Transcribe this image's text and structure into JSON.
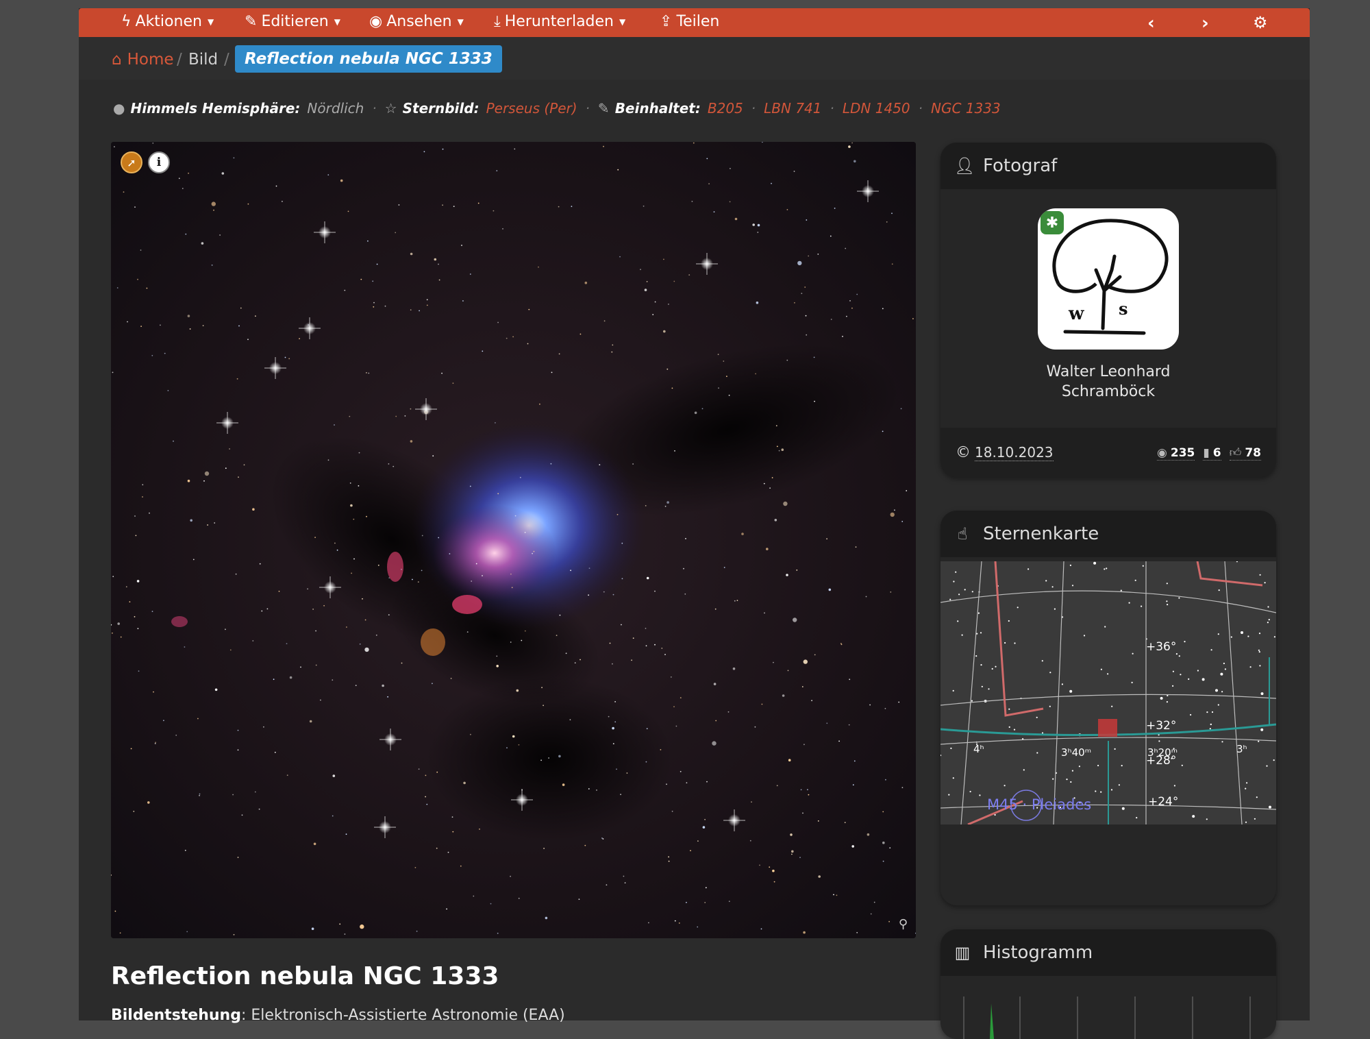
{
  "nav": {
    "actions": "Aktionen",
    "edit": "Editieren",
    "view": "Ansehen",
    "download": "Herunterladen",
    "share": "Teilen"
  },
  "breadcrumb": {
    "home": "Home",
    "sep": "/",
    "section": "Bild",
    "current": "Reflection nebula NGC 1333"
  },
  "meta": {
    "hemisphere_label": "Himmels Hemisphäre:",
    "hemisphere_value": "Nördlich",
    "constellation_label": "Sternbild:",
    "constellation_value": "Perseus (Per)",
    "contains_label": "Beinhaltet:",
    "contains": [
      "B205",
      "LBN 741",
      "LDN 1450",
      "NGC 1333"
    ],
    "sep": "·"
  },
  "image": {
    "title": "Reflection nebula NGC 1333",
    "info_badge": "i",
    "acquisition_label": "Bildentstehung",
    "acquisition_value": "Elektronisch-Assistierte Astronomie (EAA)"
  },
  "photographer_card": {
    "heading": "Fotograf",
    "name_line1": "Walter Leonhard",
    "name_line2": "Schramböck",
    "avatar_initials_w": "w",
    "avatar_initials_s": "s",
    "date": "18.10.2023",
    "views": "235",
    "bookmarks": "6",
    "likes": "78"
  },
  "skymap_card": {
    "heading": "Sternenkarte",
    "labels": {
      "dec36": "+36°",
      "dec32": "+32°",
      "dec28": "+28°",
      "dec24": "+24°",
      "ra4h": "4ʰ",
      "ra340": "3ʰ40ᵐ",
      "ra320": "3ʰ20ᵐ",
      "ra3h": "3ʰ",
      "m45": "M45 · Pleiades"
    }
  },
  "histogram_card": {
    "heading": "Histogramm"
  },
  "colors": {
    "accent": "#c9482d",
    "link": "#d2563a",
    "active_crumb": "#2f8ac9",
    "page_bg": "#2b2b2b"
  }
}
